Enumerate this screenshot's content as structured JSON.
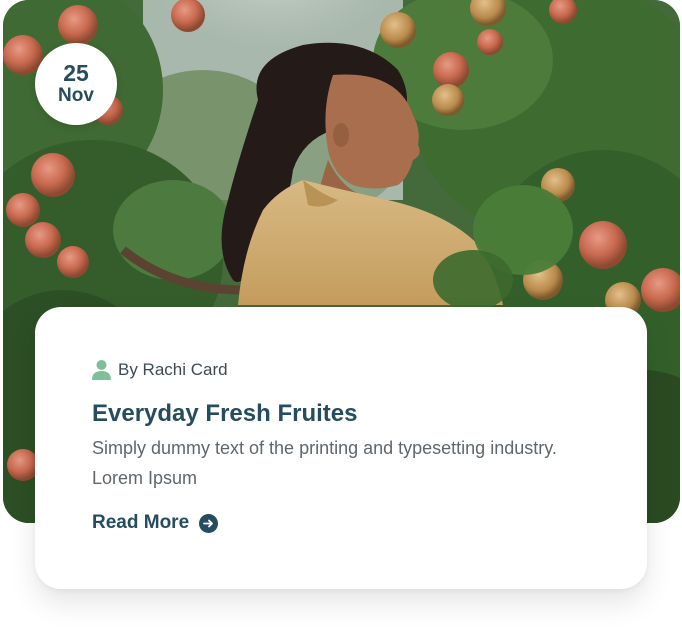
{
  "date": {
    "day": "25",
    "month": "Nov"
  },
  "image": {
    "description_icon": "photo-image"
  },
  "post": {
    "author": "By Rachi Card",
    "author_icon": "user-icon",
    "title": "Everyday Fresh Fruites",
    "excerpt": "Simply dummy text of the printing and typesetting industry. Lorem Ipsum",
    "read_more_label": "Read More",
    "read_more_icon": "arrow-right-circle-icon"
  },
  "colors": {
    "heading": "#264c5f",
    "body_text": "#5f676d",
    "author_icon": "#7fbf98",
    "card_bg": "#ffffff"
  }
}
